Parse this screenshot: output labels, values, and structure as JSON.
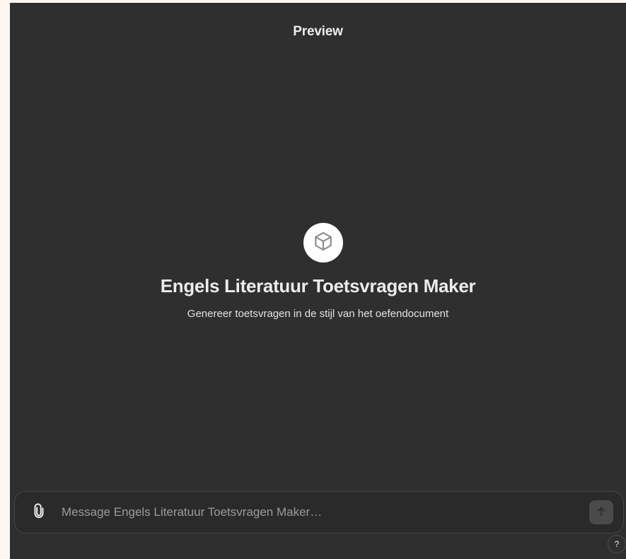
{
  "header": {
    "title": "Preview"
  },
  "gpt": {
    "icon": "cube-icon",
    "name": "Engels Literatuur Toetsvragen Maker",
    "description": "Genereer toetsvragen in de stijl van het oefendocument"
  },
  "composer": {
    "placeholder": "Message Engels Literatuur Toetsvragen Maker…",
    "value": "",
    "attach_icon": "paperclip-icon",
    "send_icon": "arrow-up-icon"
  },
  "help": {
    "label": "?"
  },
  "colors": {
    "panel_background": "#2f2f2f",
    "page_background": "#fdf7f3",
    "text_primary": "#ececec",
    "placeholder": "#9b9b9b"
  }
}
